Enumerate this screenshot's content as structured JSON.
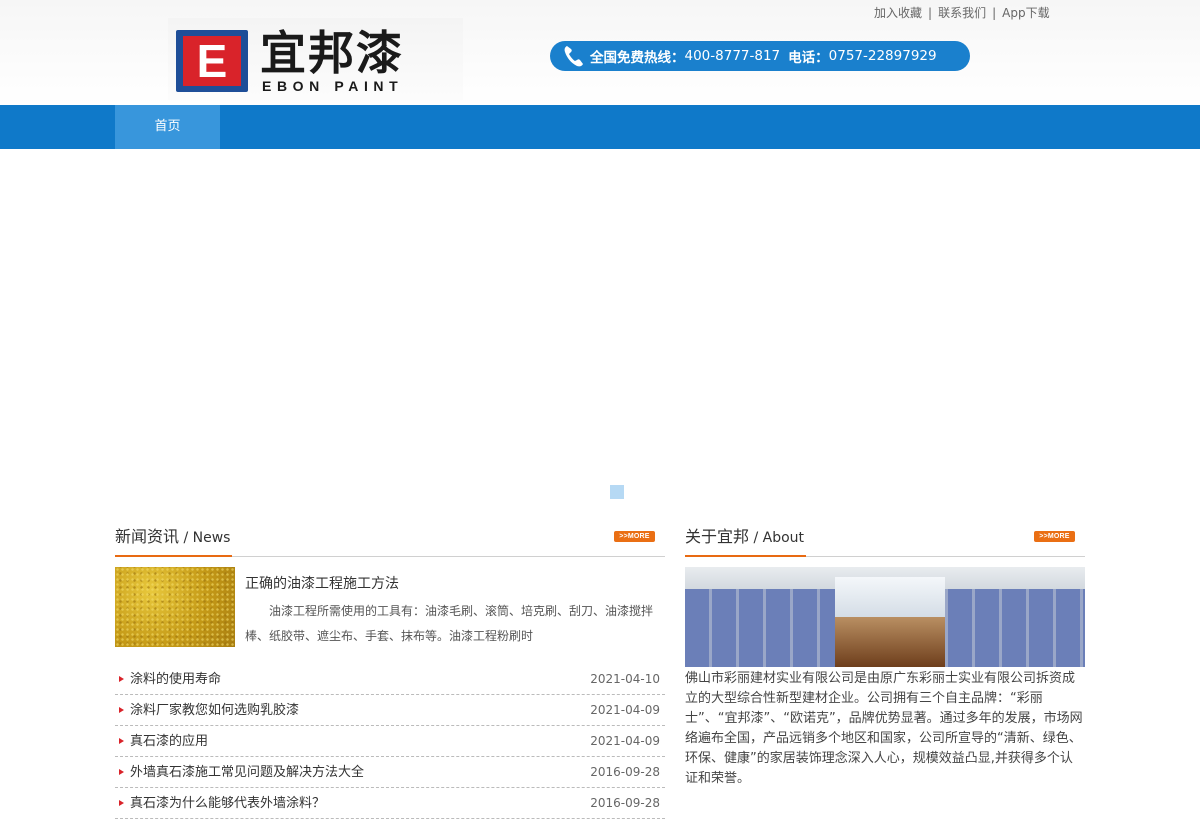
{
  "header": {
    "logo_cn": "宜邦漆",
    "logo_en": "EBON PAINT",
    "logo_mark": "E",
    "top_links": [
      "加入收藏",
      "联系我们",
      "App下载"
    ],
    "separator": "|",
    "hotline_label": "全国免费热线：",
    "hotline_number": "400-8777-817",
    "phone_label": "电话：",
    "phone_number": "0757-22897929"
  },
  "nav": {
    "items": [
      "首页"
    ]
  },
  "news": {
    "title_cn": "新闻资讯",
    "title_sep": " / ",
    "title_en": "News",
    "more": ">>MORE",
    "featured": {
      "title": "正确的油漆工程施工方法",
      "desc": "油漆工程所需使用的工具有：油漆毛刷、滚筒、培克刷、刮刀、油漆搅拌棒、纸胶带、遮尘布、手套、抹布等。油漆工程粉刷时"
    },
    "items": [
      {
        "title": "涂料的使用寿命",
        "date": "2021-04-10"
      },
      {
        "title": "涂料厂家教您如何选购乳胶漆",
        "date": "2021-04-09"
      },
      {
        "title": "真石漆的应用",
        "date": "2021-04-09"
      },
      {
        "title": "外墙真石漆施工常见问题及解决方法大全",
        "date": "2016-09-28"
      },
      {
        "title": "真石漆为什么能够代表外墙涂料？",
        "date": "2016-09-28"
      }
    ]
  },
  "about": {
    "title_cn": "关于宜邦",
    "title_sep": " / ",
    "title_en": "About",
    "more": ">>MORE",
    "text": " 佛山市彩丽建材实业有限公司是由原广东彩丽士实业有限公司拆资成立的大型综合性新型建材企业。公司拥有三个自主品牌：“彩丽士”、“宜邦漆”、“欧诺克”，品牌优势显著。通过多年的发展，市场网络遍布全国，产品远销多个地区和国家，公司所宣导的“清新、绿色、环保、健康”的家居装饰理念深入人心，规模效益凸显,并获得多个认证和荣誉。"
  },
  "colors": {
    "nav": "#0f79c9",
    "nav_active": "#3896dc",
    "hotline": "#1a80cd",
    "accent": "#e86a12"
  },
  "icons": [
    "phone-icon",
    "arrow-bullet-icon"
  ]
}
